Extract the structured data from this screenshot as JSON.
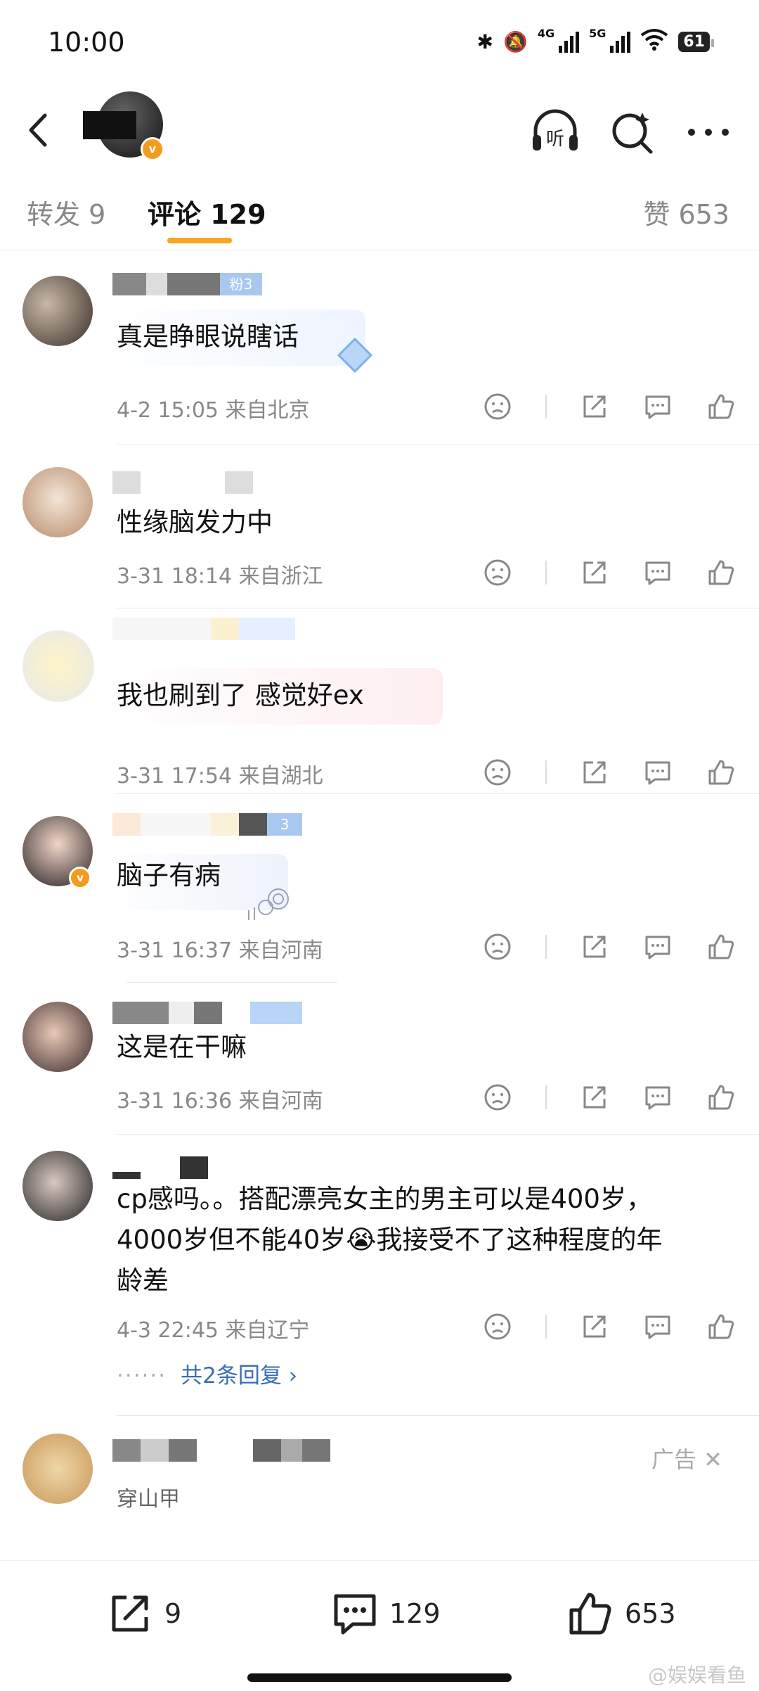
{
  "status": {
    "time": "10:00",
    "net1": "4G",
    "net2": "5G",
    "battery": "61"
  },
  "header": {
    "listen_label": "听",
    "icons": [
      "back-arrow-icon",
      "listen-headphone-icon",
      "search-sparkle-icon",
      "more-dots-icon"
    ]
  },
  "tabs": {
    "forward": "转发 9",
    "comments": "评论 129",
    "likes": "赞 653",
    "accent_color": "#f5a623"
  },
  "comments": [
    {
      "text": "真是睁眼说瞎话",
      "badge": "粉3",
      "time": "4-2 15:05",
      "location": "来自北京"
    },
    {
      "text": "性缘脑发力中",
      "time": "3-31 18:14",
      "location": "来自浙江"
    },
    {
      "text": "我也刷到了 感觉好ex",
      "time": "3-31 17:54",
      "location": "来自湖北"
    },
    {
      "text": "脑子有病",
      "badge": "3",
      "time": "3-31 16:37",
      "location": "来自河南"
    },
    {
      "text": "这是在干嘛",
      "time": "3-31 16:36",
      "location": "来自河南"
    },
    {
      "text_line1": "cp感吗。。搭配漂亮女主的男主可以是400岁，",
      "text_line2": "4000岁但不能40岁😭我接受不了这种程度的年",
      "text_line3": "龄差",
      "time": "4-3 22:45",
      "location": "来自辽宁",
      "replies": "共2条回复 ›"
    }
  ],
  "ad": {
    "label": "广告 ✕",
    "subtext": "穿山甲"
  },
  "bottom": {
    "forward_count": "9",
    "comment_count": "129",
    "like_count": "653"
  },
  "watermark": "@娱娱看鱼"
}
